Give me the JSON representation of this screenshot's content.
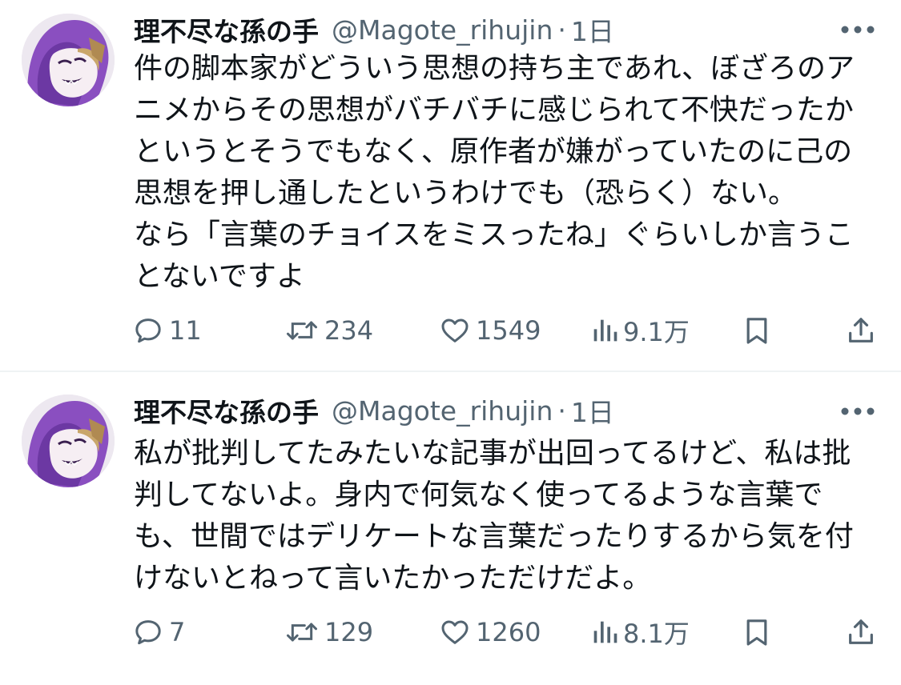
{
  "tweets": [
    {
      "author_name": "理不尽な孫の手",
      "handle": "@Magote_rihujin",
      "separator": "·",
      "time": "1日",
      "text_lines": [
        "件の脚本家がどういう思想の持ち主であれ、ぼざろのア",
        "ニメからその思想がバチバチに感じられて不快だったか",
        "というとそうでもなく、原作者が嫌がっていたのに己の",
        "思想を押し通したというわけでも（恐らく）ない。",
        "なら「言葉のチョイスをミスったね」ぐらいしか言うこ",
        "とないですよ"
      ],
      "replies": "11",
      "retweets": "234",
      "likes": "1549",
      "views": "9.1万"
    },
    {
      "author_name": "理不尽な孫の手",
      "handle": "@Magote_rihujin",
      "separator": "·",
      "time": "1日",
      "text_lines": [
        "私が批判してたみたいな記事が出回ってるけど、私は批",
        "判してないよ。身内で何気なく使ってるような言葉で",
        "も、世間ではデリケートな言葉だったりするから気を付",
        "けないとねって言いたかっただけだよ。"
      ],
      "replies": "7",
      "retweets": "129",
      "likes": "1260",
      "views": "8.1万"
    }
  ],
  "icons": {
    "more": "more-horizontal-icon",
    "reply": "reply-bubble-icon",
    "retweet": "retweet-arrows-icon",
    "like": "heart-icon",
    "views": "bar-chart-icon",
    "bookmark": "bookmark-icon",
    "share": "share-upload-icon"
  },
  "colors": {
    "text_primary": "#0f1419",
    "text_secondary": "#536471",
    "divider": "#eff3f4",
    "avatar_purple": "#8a4fc0"
  }
}
